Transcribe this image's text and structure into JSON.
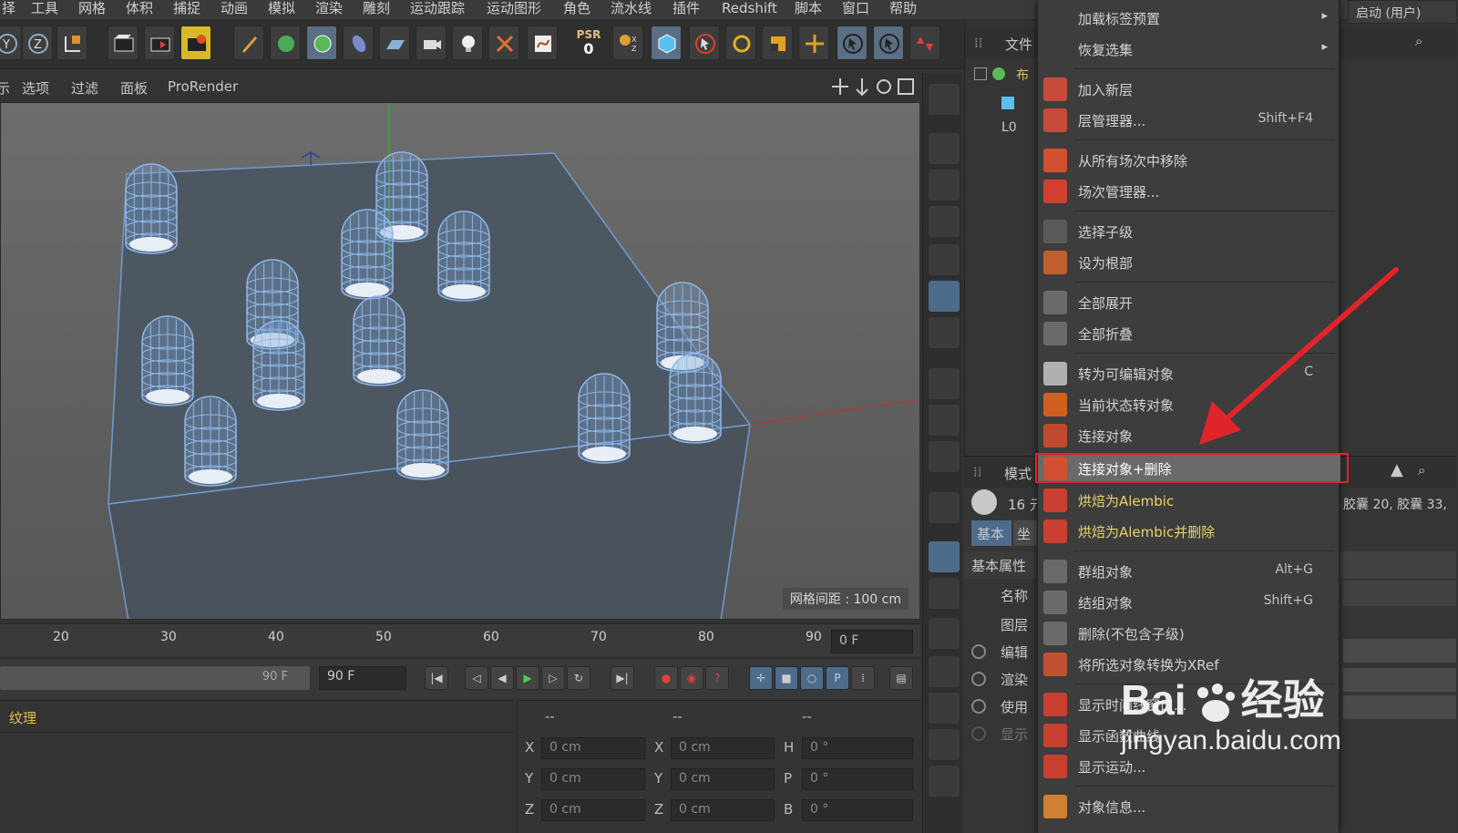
{
  "menubar": [
    "择",
    "工具",
    "网格",
    "体积",
    "捕捉",
    "动画",
    "模拟",
    "渲染",
    "雕刻",
    "运动跟踪",
    "运动图形",
    "角色",
    "流水线",
    "插件",
    "Redshift",
    "脚本",
    "窗口",
    "帮助"
  ],
  "toolbar": {
    "psr_label": "PSR",
    "psr_value": "0"
  },
  "viewport_menu": [
    "示",
    "选项",
    "过滤",
    "面板",
    "ProRender"
  ],
  "viewport": {
    "grid_label": "网格间距 : 100 cm"
  },
  "timeline": {
    "ticks": [
      "20",
      "30",
      "40",
      "50",
      "60",
      "70",
      "80",
      "90"
    ],
    "frame": "0 F"
  },
  "transport": {
    "end_frame": "90 F",
    "end_frame_field": "90 F"
  },
  "material_panel": {
    "title": "纹理"
  },
  "coord_panel": {
    "header": [
      "--",
      "--",
      "--"
    ],
    "pos": [
      {
        "label": "X",
        "value": "0 cm"
      },
      {
        "label": "Y",
        "value": "0 cm"
      },
      {
        "label": "Z",
        "value": "0 cm"
      }
    ],
    "size": [
      {
        "label": "X",
        "value": "0 cm"
      },
      {
        "label": "Y",
        "value": "0 cm"
      },
      {
        "label": "Z",
        "value": "0 cm"
      }
    ],
    "rot": [
      {
        "label": "H",
        "value": "0 °"
      },
      {
        "label": "P",
        "value": "0 °"
      },
      {
        "label": "B",
        "value": "0 °"
      }
    ]
  },
  "object_manager": {
    "menu_file": "文件",
    "startup": "启动 (用户)",
    "item1": "布",
    "item2": "L0"
  },
  "attribute_panel": {
    "mode": "模式",
    "count": "16 元",
    "tab_basic": "基本",
    "tab_coord": "坐",
    "section": "基本属性",
    "rows": [
      "名称",
      "图层",
      "编辑",
      "渲染",
      "使用",
      "显示"
    ],
    "objects_text": "胶囊 20, 胶囊 33,"
  },
  "context_menu": {
    "items": [
      {
        "label": "加载标签预置",
        "shortcut": "",
        "arrow": "▸"
      },
      {
        "label": "恢复选集",
        "shortcut": "",
        "arrow": "▸"
      },
      {
        "label": "加入新层",
        "shortcut": ""
      },
      {
        "label": "层管理器...",
        "shortcut": "Shift+F4"
      },
      {
        "label": "从所有场次中移除",
        "shortcut": ""
      },
      {
        "label": "场次管理器...",
        "shortcut": ""
      },
      {
        "label": "选择子级",
        "shortcut": ""
      },
      {
        "label": "设为根部",
        "shortcut": ""
      },
      {
        "label": "全部展开",
        "shortcut": ""
      },
      {
        "label": "全部折叠",
        "shortcut": ""
      },
      {
        "label": "转为可编辑对象",
        "shortcut": "C"
      },
      {
        "label": "当前状态转对象",
        "shortcut": ""
      },
      {
        "label": "连接对象",
        "shortcut": ""
      },
      {
        "label": "连接对象+删除",
        "shortcut": ""
      },
      {
        "label": "烘焙为Alembic",
        "shortcut": ""
      },
      {
        "label": "烘焙为Alembic并删除",
        "shortcut": ""
      },
      {
        "label": "群组对象",
        "shortcut": "Alt+G"
      },
      {
        "label": "结组对象",
        "shortcut": "Shift+G"
      },
      {
        "label": "删除(不包含子级)",
        "shortcut": ""
      },
      {
        "label": "将所选对象转换为XRef",
        "shortcut": ""
      },
      {
        "label": "显示时间线窗口...",
        "shortcut": ""
      },
      {
        "label": "显示函数曲线",
        "shortcut": ""
      },
      {
        "label": "显示运动...",
        "shortcut": ""
      },
      {
        "label": "对象信息...",
        "shortcut": ""
      }
    ]
  },
  "watermark": {
    "brand": "Bai",
    "brand2": "经验",
    "url": "jingyan.baidu.com"
  },
  "colors": {
    "highlight_box": "#e0242a",
    "arrow": "#e0242a",
    "alembic_text": "#e8d46a",
    "capsule_wire": "#8fb8e8"
  }
}
